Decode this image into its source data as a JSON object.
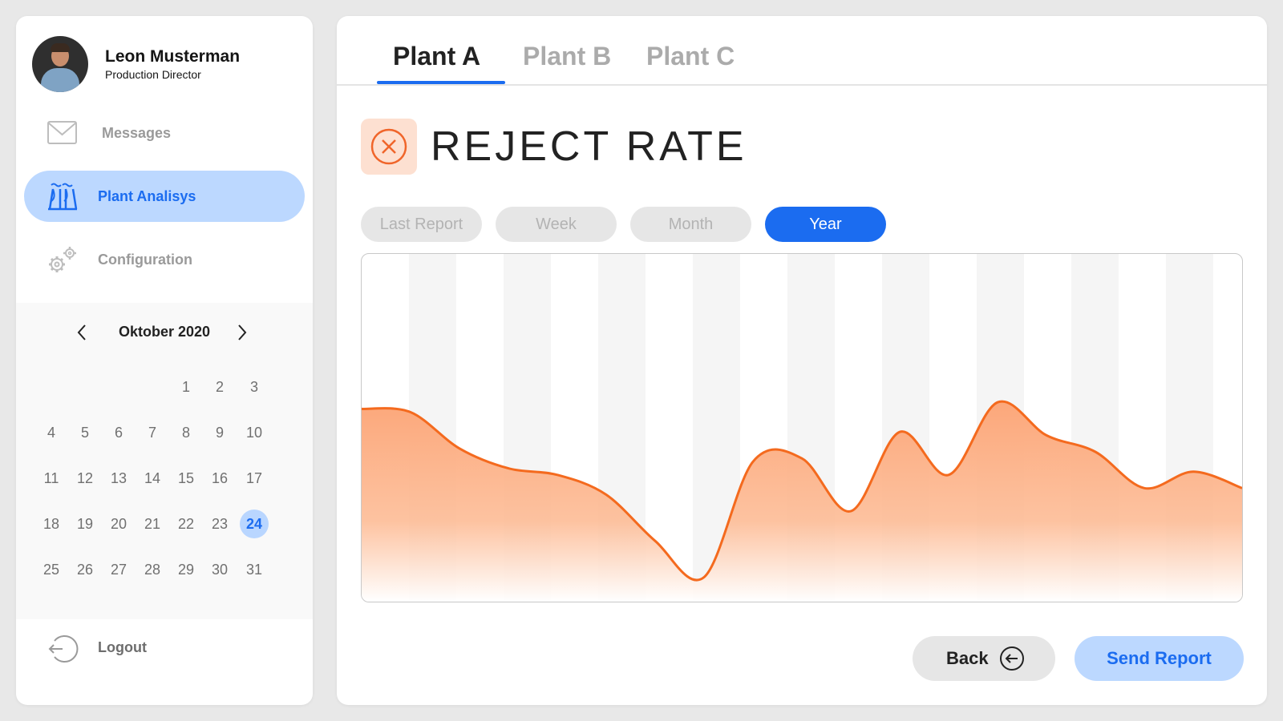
{
  "user": {
    "name": "Leon Musterman",
    "role": "Production Director"
  },
  "nav": [
    {
      "label": "Messages",
      "icon": "envelope-icon"
    },
    {
      "label": "Plant Analisys",
      "icon": "factory-icon",
      "active": true
    },
    {
      "label": "Configuration",
      "icon": "gears-icon"
    }
  ],
  "calendar": {
    "month_label": "Oktober 2020",
    "selected_day": 24,
    "weeks": [
      [
        "",
        "",
        "",
        "",
        "1",
        "2",
        "3"
      ],
      [
        "4",
        "5",
        "6",
        "7",
        "8",
        "9",
        "10"
      ],
      [
        "11",
        "12",
        "13",
        "14",
        "15",
        "16",
        "17"
      ],
      [
        "18",
        "19",
        "20",
        "21",
        "22",
        "23",
        "24"
      ],
      [
        "25",
        "26",
        "27",
        "28",
        "29",
        "30",
        "31"
      ]
    ]
  },
  "logout_label": "Logout",
  "tabs": [
    {
      "label": "Plant A",
      "active": true
    },
    {
      "label": "Plant B"
    },
    {
      "label": "Plant C"
    }
  ],
  "page_title": "REJECT RATE",
  "filters": [
    {
      "label": "Last Report"
    },
    {
      "label": "Week"
    },
    {
      "label": "Month"
    },
    {
      "label": "Year",
      "active": true
    }
  ],
  "buttons": {
    "back": "Back",
    "send": "Send Report"
  },
  "colors": {
    "accent": "#1b6cf0",
    "accent_light": "#bcd8ff",
    "chart_line": "#f46a1e",
    "chart_fill": "#fca77a",
    "reject_icon": "#f0652a"
  },
  "chart_data": {
    "type": "area",
    "title": "",
    "xlabel": "",
    "ylabel": "",
    "grid": "vertical bands",
    "ylim": [
      0,
      100
    ],
    "values": [
      55,
      54,
      43,
      37,
      35,
      29,
      15,
      4,
      39,
      40,
      24,
      48,
      35,
      57,
      47,
      42,
      31,
      36,
      31
    ]
  }
}
